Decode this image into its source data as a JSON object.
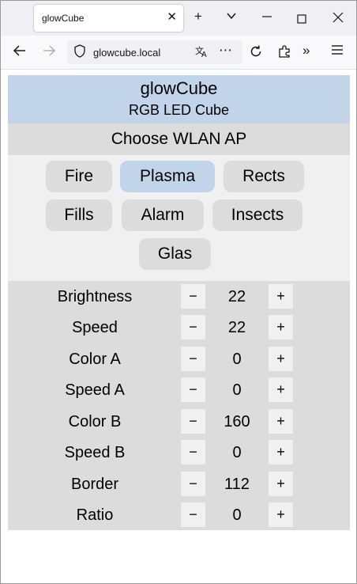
{
  "browser": {
    "tab_title": "glowCube",
    "url": "glowcube.local"
  },
  "header": {
    "title": "glowCube",
    "subtitle": "RGB LED Cube"
  },
  "wlan_label": "Choose WLAN AP",
  "modes": {
    "fire": "Fire",
    "plasma": "Plasma",
    "rects": "Rects",
    "fills": "Fills",
    "alarm": "Alarm",
    "insects": "Insects",
    "glas": "Glas",
    "active": "Plasma"
  },
  "controls": {
    "minus": "−",
    "plus": "+"
  },
  "params": [
    {
      "label": "Brightness",
      "value": "22"
    },
    {
      "label": "Speed",
      "value": "22"
    },
    {
      "label": "Color A",
      "value": "0"
    },
    {
      "label": "Speed A",
      "value": "0"
    },
    {
      "label": "Color B",
      "value": "160"
    },
    {
      "label": "Speed B",
      "value": "0"
    },
    {
      "label": "Border",
      "value": "112"
    },
    {
      "label": "Ratio",
      "value": "0"
    }
  ],
  "colors": {
    "header_bg": "#c2d4ea",
    "active_mode_bg": "#c2d4ea",
    "panel_bg": "#dcdcdc",
    "modes_bg": "#f0f0f0"
  }
}
